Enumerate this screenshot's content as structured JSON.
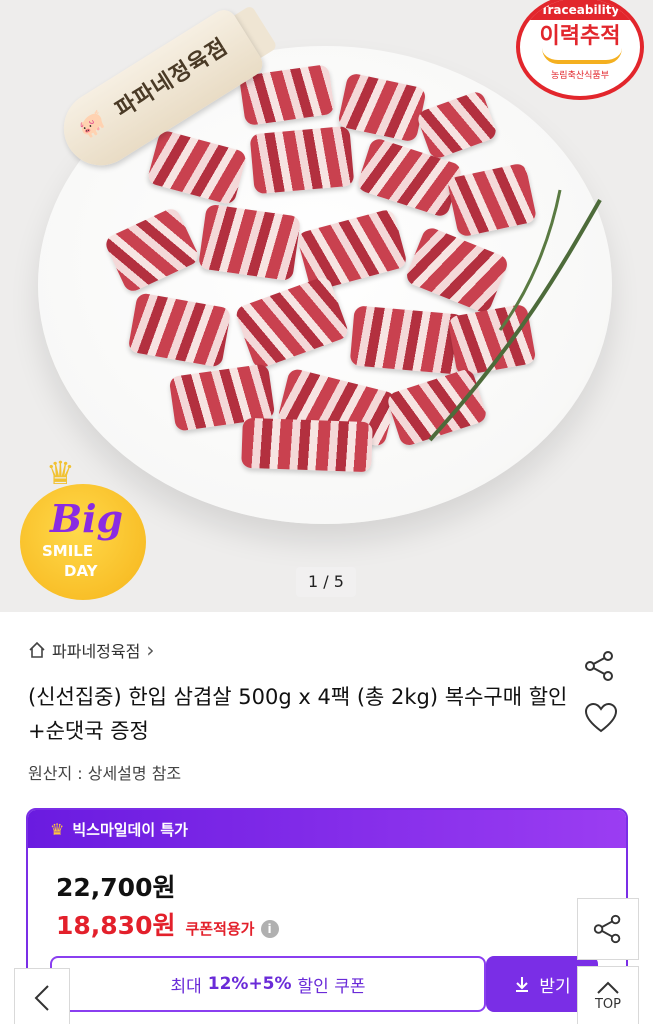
{
  "gallery": {
    "pager": "1 / 5",
    "sign_text": "파파네정육점",
    "trace_badge": {
      "top": "Traceability",
      "main": "이력추적",
      "sub": "농림축산식품부"
    },
    "event_badge": {
      "big": "Big",
      "line1": "SMILE",
      "line2": "DAY"
    }
  },
  "store": {
    "name": "파파네정육점",
    "chevron": "›"
  },
  "product": {
    "title": "(신선집중) 한입 삼겹살 500g x 4팩 (총 2kg) 복수구매 할인+순댓국 증정",
    "origin": "원산지 : 상세설명 참조"
  },
  "promo": {
    "header": "빅스마일데이 특가",
    "original_price": "22,700원",
    "sale_price": "18,830원",
    "coupon_applied": "쿠폰적용가",
    "info_icon": "i"
  },
  "coupon": {
    "prefix": "최대",
    "amount": "12%+5%",
    "suffix": "할인 쿠폰",
    "download": "받기"
  },
  "floating": {
    "top_label": "TOP"
  },
  "colors": {
    "accent_purple": "#7a2ee6",
    "sale_red": "#e3202b",
    "badge_red": "#e2262c"
  },
  "icons": [
    "home-icon",
    "share-icon",
    "heart-icon",
    "crown-icon",
    "info-icon",
    "download-icon",
    "chevron-left-icon",
    "chevron-up-icon"
  ]
}
